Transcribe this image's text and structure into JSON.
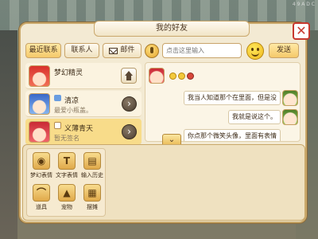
{
  "panel": {
    "title": "我的好友",
    "close_label": "✕"
  },
  "tabs": {
    "recent": "最近联系",
    "contacts": "联系人",
    "mail": "邮件"
  },
  "contacts": [
    {
      "name": "梦幻精灵",
      "subtitle": ""
    },
    {
      "name": "清凉",
      "subtitle": "最爱小瓶盖。"
    },
    {
      "name": "义薄青天",
      "subtitle": "暂无签名"
    }
  ],
  "chat": {
    "placeholder": "点击这里输入",
    "send_label": "发送",
    "messages": [
      {
        "text": "我当人知道那个在里面，但是没"
      },
      {
        "text": "我就是说这个。"
      },
      {
        "text": "你点那个微笑头像，里面有表情"
      }
    ]
  },
  "tools": [
    {
      "label": "梦幻表情",
      "icon": "bear-icon",
      "glyph": "◉"
    },
    {
      "label": "文字表情",
      "icon": "text-icon",
      "glyph": "T"
    },
    {
      "label": "输入历史",
      "icon": "history-icon",
      "glyph": "▤"
    },
    {
      "label": "道具",
      "icon": "item-icon",
      "glyph": "⌒"
    },
    {
      "label": "宠物",
      "icon": "pet-icon",
      "glyph": "▲"
    },
    {
      "label": "摆摊",
      "icon": "stall-icon",
      "glyph": "▦"
    }
  ],
  "watermark": "4 9 A D C"
}
